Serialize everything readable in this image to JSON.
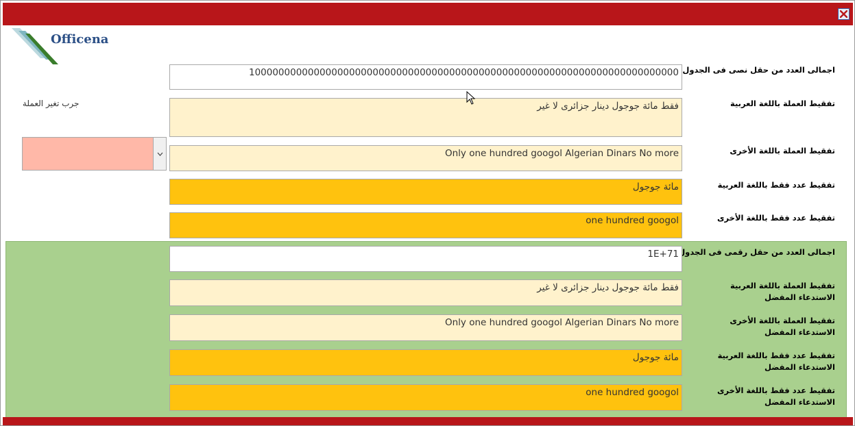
{
  "app": {
    "brand": "Officena",
    "close_icon": "close-icon",
    "colors": {
      "titlebar": "#b8161a",
      "white_field": "#ffffff",
      "cream_field": "#fff2cc",
      "gold_field": "#ffc20e",
      "green_panel": "#a9d08e",
      "combo": "#ffb8a8"
    }
  },
  "side": {
    "try_currency_label": "جرب تغير العملة",
    "currency_combo_value": ""
  },
  "text_section": {
    "total_label": "اجمالى العدد من حقل نصى فى الجدول",
    "total_value": "1000000000000000000000000000000000000000000000000000000000000000000000000",
    "currency_ar_label": "تفقيط العملة باللغة العربية",
    "currency_ar_value": "فقط مائة جوجول دينار جزائرى لا غير",
    "currency_other_label": "تفقيط العملة باللغة الأخرى",
    "currency_other_value": "Only one hundred googol Algerian Dinars No more",
    "number_ar_label": "تفقيط عدد فقط باللغة العربية",
    "number_ar_value": "مائة جوجول",
    "number_other_label": "تفقيط عدد فقط باللغة الأخرى",
    "number_other_value": "one hundred googol"
  },
  "numeric_section": {
    "total_label": "اجمالى العدد من حقل رقمى فى الجدول",
    "total_value": "1E+71",
    "preferred_suffix": "الاستدعاء المفضل",
    "currency_ar_label": "تفقيط العملة باللغة العربية",
    "currency_ar_value": "فقط مائة جوجول دينار جزائرى لا غير",
    "currency_other_label": "تفقيط العملة باللغة الأخرى",
    "currency_other_value": "Only one hundred googol Algerian Dinars No more",
    "number_ar_label": "تفقيط عدد فقط باللغة العربية",
    "number_ar_value": "مائة جوجول",
    "number_other_label": "تفقيط عدد فقط باللغة الأخرى",
    "number_other_value": "one hundred googol"
  }
}
